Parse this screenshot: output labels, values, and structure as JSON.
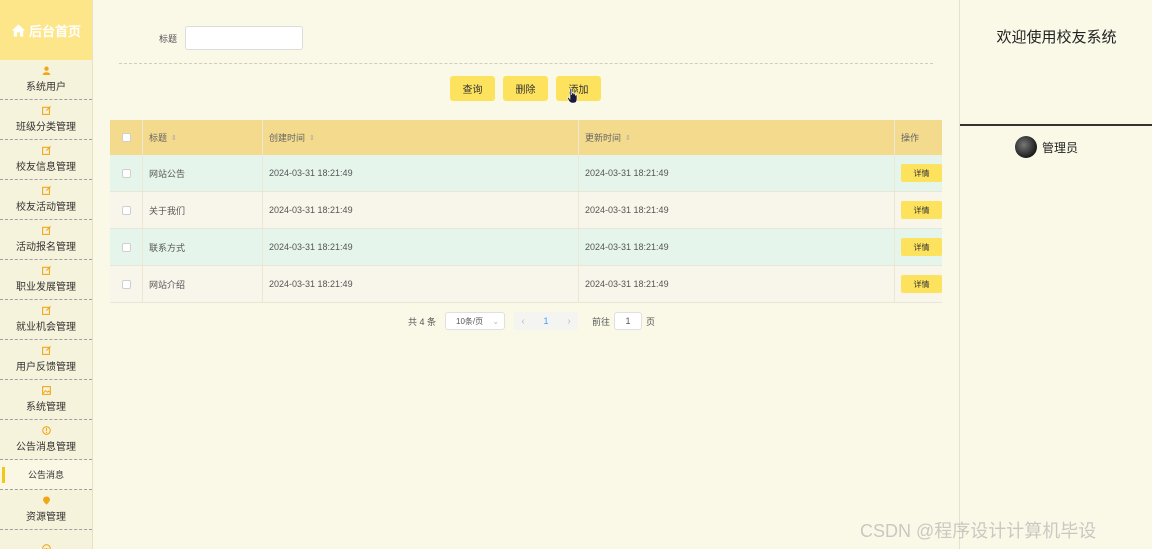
{
  "sidebar": {
    "brand": "后台首页",
    "items": [
      {
        "label": "系统用户",
        "icon": "user-icon"
      },
      {
        "label": "班级分类管理",
        "icon": "edit-icon"
      },
      {
        "label": "校友信息管理",
        "icon": "edit-icon"
      },
      {
        "label": "校友活动管理",
        "icon": "edit-icon"
      },
      {
        "label": "活动报名管理",
        "icon": "edit-icon"
      },
      {
        "label": "职业发展管理",
        "icon": "edit-icon"
      },
      {
        "label": "就业机会管理",
        "icon": "edit-icon"
      },
      {
        "label": "用户反馈管理",
        "icon": "edit-icon"
      },
      {
        "label": "系统管理",
        "icon": "picture-icon"
      },
      {
        "label": "公告消息管理",
        "icon": "info-icon"
      }
    ],
    "active_sub": "公告消息",
    "after_items": [
      {
        "label": "资源管理",
        "icon": "location-icon"
      }
    ]
  },
  "search": {
    "label": "标题",
    "value": ""
  },
  "toolbar": {
    "query_label": "查询",
    "delete_label": "删除",
    "add_label": "添加"
  },
  "table": {
    "headers": {
      "title": "标题",
      "created": "创建时间",
      "updated": "更新时间",
      "op": "操作"
    },
    "rows": [
      {
        "title": "网站公告",
        "created": "2024-03-31 18:21:49",
        "updated": "2024-03-31 18:21:49",
        "action": "详情"
      },
      {
        "title": "关于我们",
        "created": "2024-03-31 18:21:49",
        "updated": "2024-03-31 18:21:49",
        "action": "详情"
      },
      {
        "title": "联系方式",
        "created": "2024-03-31 18:21:49",
        "updated": "2024-03-31 18:21:49",
        "action": "详情"
      },
      {
        "title": "网站介绍",
        "created": "2024-03-31 18:21:49",
        "updated": "2024-03-31 18:21:49",
        "action": "详情"
      }
    ]
  },
  "pagination": {
    "total": "共 4 条",
    "page_size": "10条/页",
    "current_page": "1",
    "goto_label": "前往",
    "goto_value": "1",
    "page_unit": "页"
  },
  "right_panel": {
    "welcome": "欢迎使用校友系统",
    "username": "管理员"
  },
  "watermark": "CSDN @程序设计计算机毕设",
  "colors": {
    "accent": "#fde25d",
    "brand_bg": "#fde58a",
    "header_bg": "#f3da8c",
    "row_even": "#e6f5ec",
    "row_odd": "#f8f5ea"
  }
}
